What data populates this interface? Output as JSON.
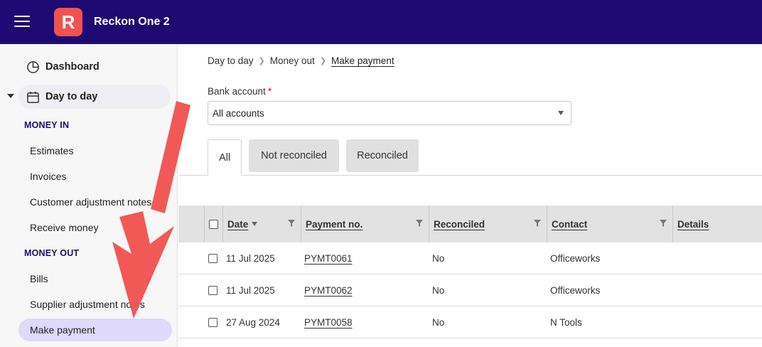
{
  "header": {
    "logo_letter": "R",
    "app_title": "Reckon One 2",
    "menu_icon": "hamburger-menu-icon"
  },
  "sidebar": {
    "dashboard_label": "Dashboard",
    "dashboard_icon": "pie-chart-icon",
    "day_to_day_label": "Day to day",
    "day_to_day_icon": "calendar-icon",
    "money_in_heading": "MONEY IN",
    "money_in_items": [
      "Estimates",
      "Invoices",
      "Customer adjustment notes",
      "Receive money"
    ],
    "money_out_heading": "MONEY OUT",
    "money_out_items": [
      "Bills",
      "Supplier adjustment notes",
      "Make payment"
    ],
    "active_item": "Make payment"
  },
  "breadcrumb": {
    "items": [
      "Day to day",
      "Money out",
      "Make payment"
    ]
  },
  "filters": {
    "bank_account_label": "Bank account",
    "required_marker": "*",
    "bank_account_value": "All accounts"
  },
  "tabs": {
    "items": [
      "All",
      "Not reconciled",
      "Reconciled"
    ],
    "active": "All"
  },
  "table": {
    "columns": [
      "Date",
      "Payment no.",
      "Reconciled",
      "Contact",
      "Details"
    ],
    "rows": [
      {
        "date": "11 Jul 2025",
        "payment_no": "PYMT0061",
        "reconciled": "No",
        "contact": "Officeworks",
        "details": ""
      },
      {
        "date": "11 Jul 2025",
        "payment_no": "PYMT0062",
        "reconciled": "No",
        "contact": "Officeworks",
        "details": ""
      },
      {
        "date": "27 Aug 2024",
        "payment_no": "PYMT0058",
        "reconciled": "No",
        "contact": "N Tools",
        "details": ""
      }
    ]
  },
  "colors": {
    "topbar": "#1e0a72",
    "logo": "#f0524f",
    "active_nav": "#dfd9fb",
    "annotation_arrow": "#f0524f"
  }
}
